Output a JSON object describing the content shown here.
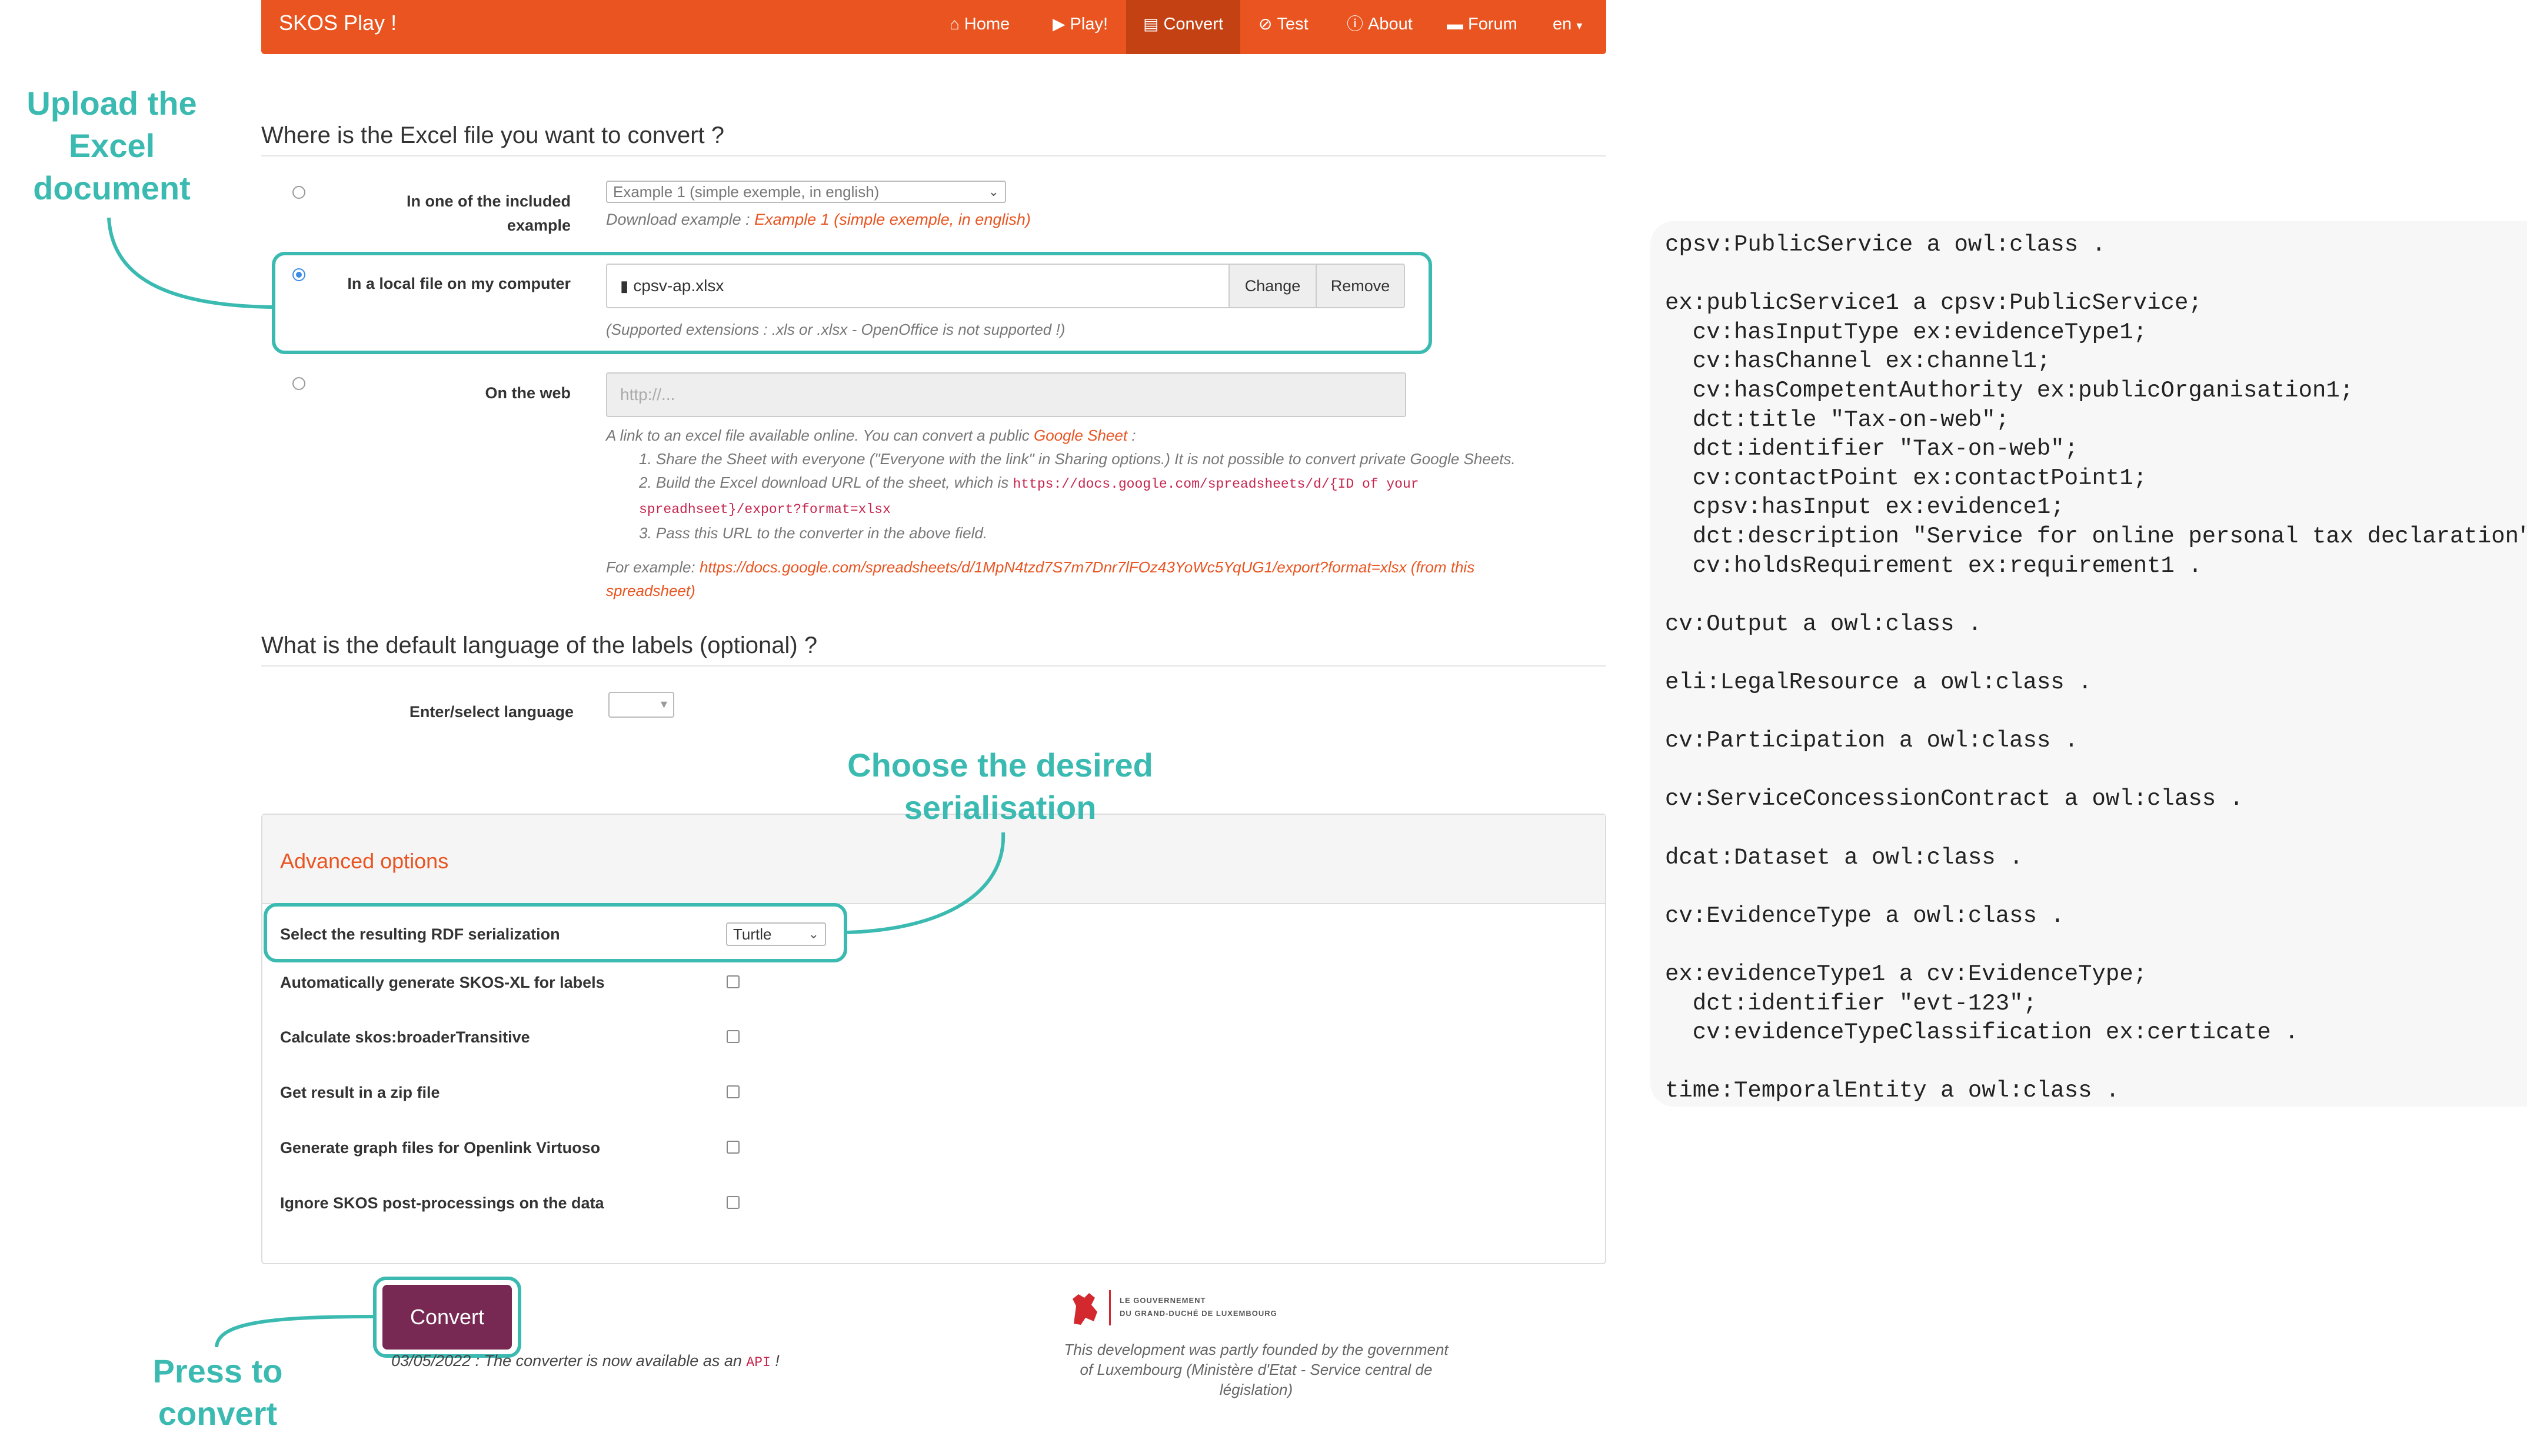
{
  "navbar": {
    "brand": "SKOS Play !",
    "items": [
      {
        "label": "Home",
        "icon": "home-icon"
      },
      {
        "label": "Play!",
        "icon": "play-icon"
      },
      {
        "label": "Convert",
        "icon": "list-icon",
        "active": true
      },
      {
        "label": "Test",
        "icon": "check-circle-icon"
      },
      {
        "label": "About",
        "icon": "info-icon"
      },
      {
        "label": "Forum",
        "icon": "comment-icon"
      },
      {
        "label": "en",
        "icon": "caret-down-icon"
      }
    ],
    "accent": "#e95420",
    "active_color": "#c34113"
  },
  "upload": {
    "heading": "Where is the Excel file you want to convert ?",
    "example_label": "In one of the included example",
    "example_select": "Example 1 (simple exemple, in english)",
    "download_prefix": "Download example :",
    "download_link": "Example 1 (simple exemple, in english)",
    "local_label": "In a local file on my computer",
    "file_name": "cpsv-ap.xlsx",
    "change_btn": "Change",
    "remove_btn": "Remove",
    "supported": "(Supported extensions : .xls or .xlsx - OpenOffice is not supported !)",
    "web_label": "On the web",
    "web_placeholder": "http://...",
    "web_help_intro": "A link to an excel file available online. You can convert a public",
    "google_sheet": "Google Sheet",
    "web_help_colon": ":",
    "step1": "1. Share the Sheet with everyone (\"Everyone with the link\" in Sharing options.) It is not possible to convert private Google Sheets.",
    "step2_text": "2. Build the Excel download URL of the sheet, which is",
    "step2_code_a": "https://docs.google.com/spreadsheets/d/{ID of your",
    "step2_code_b": "spreadhseet}/export?format=xlsx",
    "step3": "3. Pass this URL to the converter in the above field.",
    "example_prefix": "For example:",
    "example_url": "https://docs.google.com/spreadsheets/d/1MpN4tzd7S7m7Dnr7lFOz43YoWc5YqUG1/export?format=xlsx",
    "from_this_a": "(from this",
    "from_this_b": "spreadsheet)"
  },
  "language": {
    "heading": "What is the default language of the labels (optional) ?",
    "label": "Enter/select language"
  },
  "advanced": {
    "title": "Advanced options",
    "serialization_label": "Select the resulting RDF serialization",
    "serialization_value": "Turtle",
    "options": [
      "Automatically generate SKOS-XL for labels",
      "Calculate skos:broaderTransitive",
      "Get result in a zip file",
      "Generate graph files for Openlink Virtuoso",
      "Ignore SKOS post-processings on the data"
    ]
  },
  "convert": {
    "button": "Convert",
    "note_prefix": "03/05/2022 : The converter is now available as an",
    "note_api": "API",
    "note_suffix": "!"
  },
  "footer": {
    "gov_line1": "LE GOUVERNEMENT",
    "gov_line2": "DU GRAND-DUCHÉ DE LUXEMBOURG",
    "funding": "This development was partly founded by the government of Luxembourg (Ministère d'Etat - Service central de législation)"
  },
  "annotations": {
    "upload": "Upload the Excel document",
    "serialisation": "Choose the desired serialisation",
    "press": "Press to convert",
    "color": "#3bbab1"
  },
  "code": [
    "cpsv:PublicService a owl:class .",
    "",
    "ex:publicService1 a cpsv:PublicService;",
    "  cv:hasInputType ex:evidenceType1;",
    "  cv:hasChannel ex:channel1;",
    "  cv:hasCompetentAuthority ex:publicOrganisation1;",
    "  dct:title \"Tax-on-web\";",
    "  dct:identifier \"Tax-on-web\";",
    "  cv:contactPoint ex:contactPoint1;",
    "  cpsv:hasInput ex:evidence1;",
    "  dct:description \"Service for online personal tax declaration\";",
    "  cv:holdsRequirement ex:requirement1 .",
    "",
    "cv:Output a owl:class .",
    "",
    "eli:LegalResource a owl:class .",
    "",
    "cv:Participation a owl:class .",
    "",
    "cv:ServiceConcessionContract a owl:class .",
    "",
    "dcat:Dataset a owl:class .",
    "",
    "cv:EvidenceType a owl:class .",
    "",
    "ex:evidenceType1 a cv:EvidenceType;",
    "  dct:identifier \"evt-123\";",
    "  cv:evidenceTypeClassification ex:certicate .",
    "",
    "time:TemporalEntity a owl:class ."
  ]
}
